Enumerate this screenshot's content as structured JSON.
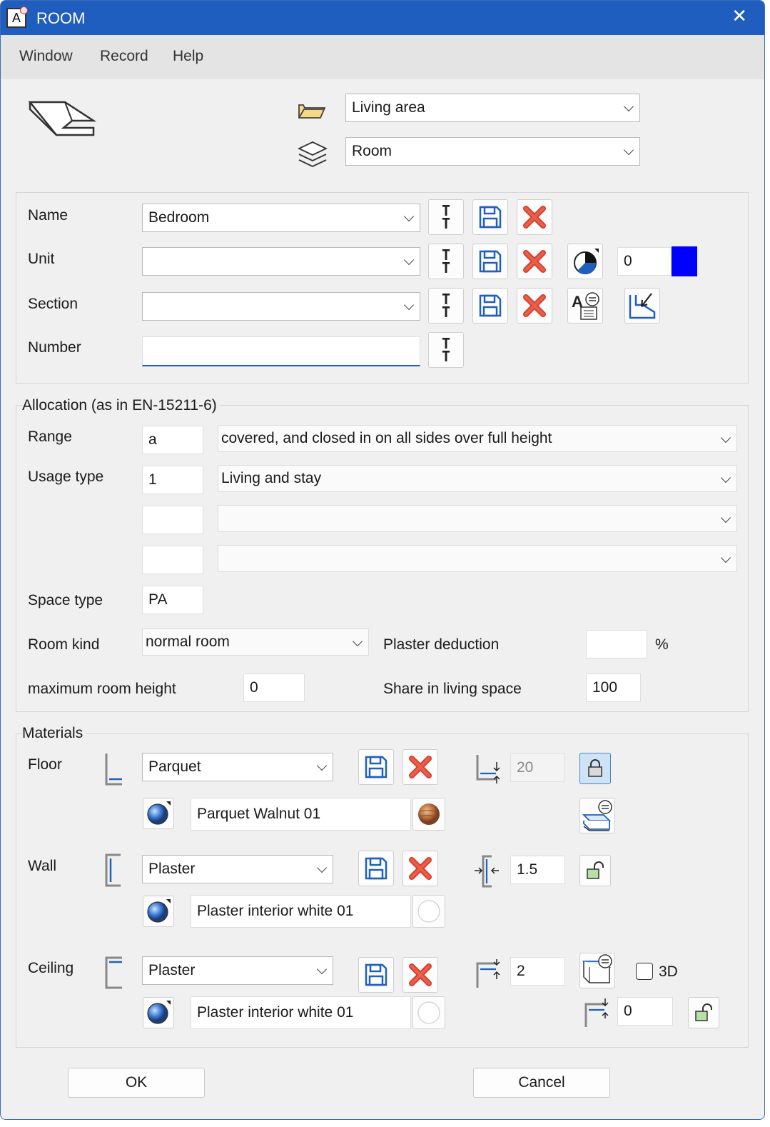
{
  "window": {
    "title": "ROOM",
    "icon_letter": "A",
    "close_glyph": "✕"
  },
  "menu": [
    "Window",
    "Record",
    "Help"
  ],
  "top": {
    "folder_value": "Living area",
    "layer_value": "Room"
  },
  "identification": {
    "name_label": "Name",
    "name_value": "Bedroom",
    "unit_label": "Unit",
    "unit_value": "",
    "unit_number": "0",
    "unit_color": "#0000ff",
    "section_label": "Section",
    "section_value": "",
    "number_label": "Number",
    "number_value": ""
  },
  "allocation": {
    "title": "Allocation (as in EN-15211-6)",
    "range_label": "Range",
    "range_code": "a",
    "range_text": "covered, and closed in on all sides over full height",
    "usage_label": "Usage type",
    "usage_code": "1",
    "usage_text": "Living and stay",
    "usage2_code": "",
    "usage2_text": "",
    "usage3_code": "",
    "usage3_text": "",
    "space_label": "Space type",
    "space_value": "PA",
    "kind_label": "Room kind",
    "kind_value": "normal room",
    "plaster_label": "Plaster deduction",
    "plaster_value": "",
    "plaster_unit": "%",
    "maxh_label": "maximum room height",
    "maxh_value": "0",
    "share_label": "Share in living space",
    "share_value": "100"
  },
  "materials": {
    "title": "Materials",
    "floor": {
      "label": "Floor",
      "material": "Parquet",
      "surface": "Parquet Walnut 01",
      "thickness": "20",
      "locked": true
    },
    "wall": {
      "label": "Wall",
      "material": "Plaster",
      "surface": "Plaster interior white 01",
      "thickness": "1.5",
      "locked": false
    },
    "ceiling": {
      "label": "Ceiling",
      "material": "Plaster",
      "surface": "Plaster interior white 01",
      "thickness": "2",
      "offset": "0",
      "checkbox_label": "3D",
      "checked": false
    }
  },
  "buttons": {
    "ok": "OK",
    "cancel": "Cancel"
  }
}
